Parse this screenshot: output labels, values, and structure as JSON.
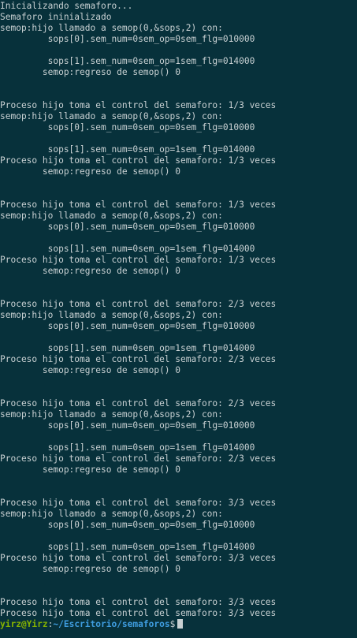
{
  "terminal": {
    "lines": [
      "Inicializando semaforo...",
      "Semaforo ininializado",
      "semop:hijo llamado a semop(0,&sops,2) con:",
      "         sops[0].sem_num=0sem_op=0sem_flg=010000",
      "",
      "         sops[1].sem_num=0sem_op=1sem_flg=014000",
      "        semop:regreso de semop() 0",
      "",
      "",
      "Proceso hijo toma el control del semaforo: 1/3 veces",
      "semop:hijo llamado a semop(0,&sops,2) con:",
      "         sops[0].sem_num=0sem_op=0sem_flg=010000",
      "",
      "         sops[1].sem_num=0sem_op=1sem_flg=014000",
      "Proceso hijo toma el control del semaforo: 1/3 veces",
      "        semop:regreso de semop() 0",
      "",
      "",
      "Proceso hijo toma el control del semaforo: 1/3 veces",
      "semop:hijo llamado a semop(0,&sops,2) con:",
      "         sops[0].sem_num=0sem_op=0sem_flg=010000",
      "",
      "         sops[1].sem_num=0sem_op=1sem_flg=014000",
      "Proceso hijo toma el control del semaforo: 1/3 veces",
      "        semop:regreso de semop() 0",
      "",
      "",
      "Proceso hijo toma el control del semaforo: 2/3 veces",
      "semop:hijo llamado a semop(0,&sops,2) con:",
      "         sops[0].sem_num=0sem_op=0sem_flg=010000",
      "",
      "         sops[1].sem_num=0sem_op=1sem_flg=014000",
      "Proceso hijo toma el control del semaforo: 2/3 veces",
      "        semop:regreso de semop() 0",
      "",
      "",
      "Proceso hijo toma el control del semaforo: 2/3 veces",
      "semop:hijo llamado a semop(0,&sops,2) con:",
      "         sops[0].sem_num=0sem_op=0sem_flg=010000",
      "",
      "         sops[1].sem_num=0sem_op=1sem_flg=014000",
      "Proceso hijo toma el control del semaforo: 2/3 veces",
      "        semop:regreso de semop() 0",
      "",
      "",
      "Proceso hijo toma el control del semaforo: 3/3 veces",
      "semop:hijo llamado a semop(0,&sops,2) con:",
      "         sops[0].sem_num=0sem_op=0sem_flg=010000",
      "",
      "         sops[1].sem_num=0sem_op=1sem_flg=014000",
      "Proceso hijo toma el control del semaforo: 3/3 veces",
      "        semop:regreso de semop() 0",
      "",
      "",
      "Proceso hijo toma el control del semaforo: 3/3 veces",
      "Proceso hijo toma el control del semaforo: 3/3 veces"
    ],
    "prompt": {
      "user_host": "yirz@Yirz",
      "separator": ":",
      "path": "~/Escritorio/semaforos",
      "symbol": "$"
    },
    "colors": {
      "background": "#07313b",
      "text": "#c9d1d3",
      "user_host": "#86b300",
      "path": "#3f9de0"
    }
  }
}
